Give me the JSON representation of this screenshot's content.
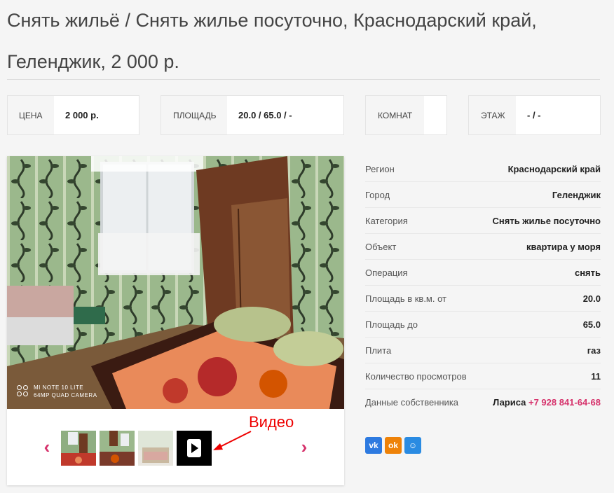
{
  "listing": {
    "title": "Снять жильё / Снять жилье посуточно, Краснодарский край, Геленджик, 2 000 р."
  },
  "stats": [
    {
      "label": "ЦЕНА",
      "value": "2 000 р."
    },
    {
      "label": "ПЛОЩАДЬ",
      "value": "20.0 / 65.0 / -"
    },
    {
      "label": "КОМНАТ",
      "value": ""
    },
    {
      "label": "ЭТАЖ",
      "value": "- / -"
    }
  ],
  "photo": {
    "camera_mark_line1": "MI NOTE 10 LITE",
    "camera_mark_line2": "64MP QUAD CAMERA"
  },
  "gallery": {
    "prev_icon": "chevron-left-icon",
    "next_icon": "chevron-right-icon",
    "annotation": "Видео"
  },
  "properties": [
    {
      "key": "Регион",
      "value": "Краснодарский край"
    },
    {
      "key": "Город",
      "value": "Геленджик"
    },
    {
      "key": "Категория",
      "value": "Снять жилье посуточно"
    },
    {
      "key": "Объект",
      "value": "квартира у моря"
    },
    {
      "key": "Операция",
      "value": "снять"
    },
    {
      "key": "Площадь в кв.м. от",
      "value": "20.0"
    },
    {
      "key": "Площадь до",
      "value": "65.0"
    },
    {
      "key": "Плита",
      "value": "газ"
    },
    {
      "key": "Количество просмотров",
      "value": "11"
    }
  ],
  "owner": {
    "key": "Данные собственника",
    "name": "Лариса",
    "phone": "+7 928 841-64-68"
  },
  "social": [
    {
      "name": "vk",
      "glyph": "vk",
      "color": "#2d7ae0"
    },
    {
      "name": "odnoklassniki",
      "glyph": "ok",
      "color": "#ee8208"
    },
    {
      "name": "moimir",
      "glyph": "☺",
      "color": "#2a8be2"
    }
  ],
  "colors": {
    "accent": "#d6336c"
  }
}
